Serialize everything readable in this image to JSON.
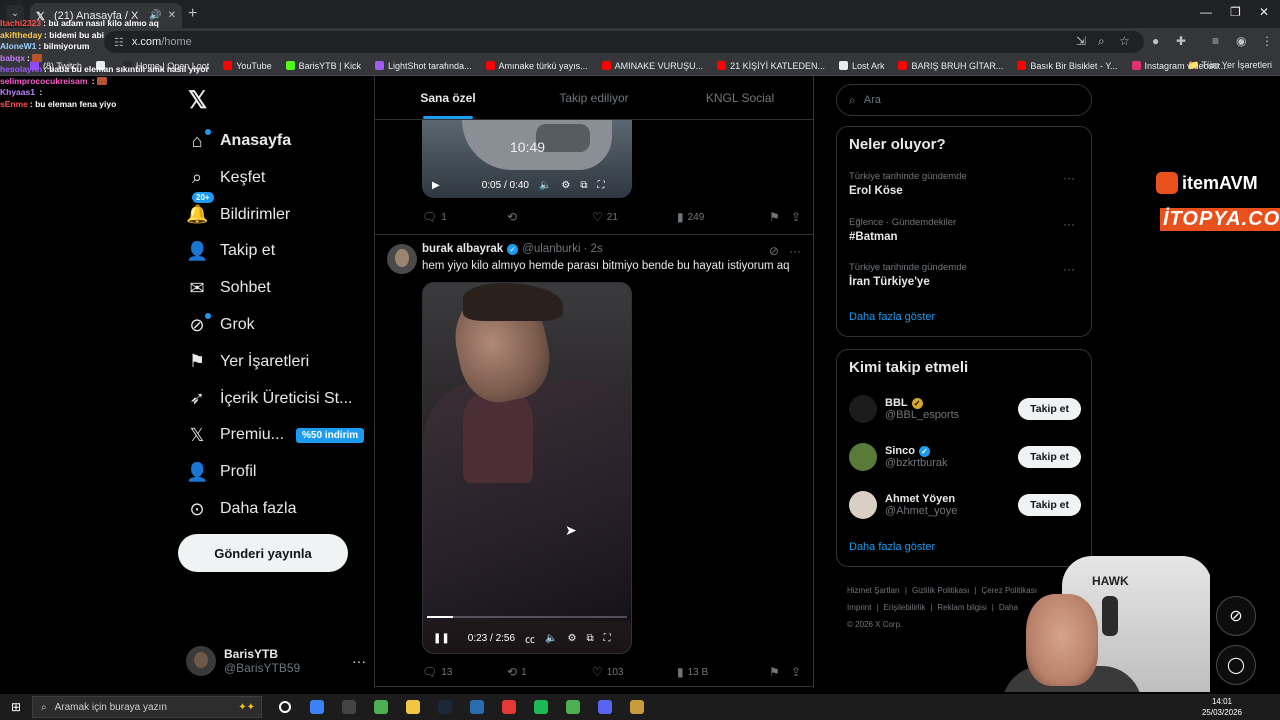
{
  "browser": {
    "tab": {
      "title": "(21) Anasayfa / X",
      "favicon": "x-logo-icon",
      "close": "✕"
    },
    "url_host": "x.com",
    "url_path": "/home",
    "bookmarks": [
      {
        "label": "(8) Twitch",
        "color": "#9146ff"
      },
      {
        "label": "",
        "color": "#e8eaed"
      },
      {
        "label": "Home | Open Loot",
        "color": "#2a2a2a"
      },
      {
        "label": "YouTube",
        "color": "#ff0000"
      },
      {
        "label": "BarisYTB | Kick",
        "color": "#53fc18"
      },
      {
        "label": "LightShot tarafında...",
        "color": "#a05cf0"
      },
      {
        "label": "Amınake türkü yayıs...",
        "color": "#ff0000"
      },
      {
        "label": "AMINAKE VURUŞU...",
        "color": "#ff0000"
      },
      {
        "label": "21 KİŞİYİ KATLEDEN...",
        "color": "#ff0000"
      },
      {
        "label": "Lost Ark",
        "color": "#e8eaed"
      },
      {
        "label": "BARIŞ BRUH GİTAR...",
        "color": "#ff0000"
      },
      {
        "label": "Basık Bir Bisiklet - Y...",
        "color": "#ff0000"
      },
      {
        "label": "Instagram videosu:...",
        "color": "#e1306c"
      }
    ],
    "all_bookmarks": "Tüm Yer İşaretleri"
  },
  "chat": [
    {
      "user": "Itachi2323",
      "color": "#ff4d4d",
      "text": ": bu adam nasıl kilo almıo aq"
    },
    {
      "user": "akiftheday",
      "color": "#f2c94c",
      "text": ": bidemi bu abi"
    },
    {
      "user": "AloneW1",
      "color": "#9ad0ff",
      "text": ": bilmiyorum"
    },
    {
      "user": "babqx",
      "color": "#c77dff",
      "text": ": "
    },
    {
      "user": "hesolaynn",
      "color": "#9b59ff",
      "text": ": baba bu eleman sıkıntılı amk nasıl yiyor"
    },
    {
      "user": "selimprococukreisam",
      "color": "#ff5ccd",
      "text": " : "
    },
    {
      "user": "Khyaas1",
      "color": "#c084fc",
      "text": " : "
    },
    {
      "user": "sEnme",
      "color": "#ff4d4d",
      "text": ": bu eleman fena yiyo"
    }
  ],
  "nav": {
    "items": [
      {
        "label": "Anasayfa",
        "icon": "home-icon"
      },
      {
        "label": "Keşfet",
        "icon": "search-icon"
      },
      {
        "label": "Bildirimler",
        "icon": "bell-icon",
        "badge": "20+"
      },
      {
        "label": "Takip et",
        "icon": "follow-icon"
      },
      {
        "label": "Sohbet",
        "icon": "mail-icon"
      },
      {
        "label": "Grok",
        "icon": "grok-icon"
      },
      {
        "label": "Yer İşaretleri",
        "icon": "bookmark-icon"
      },
      {
        "label": "İçerik Üreticisi St...",
        "icon": "rocket-icon"
      },
      {
        "label": "Premiu...",
        "icon": "x-premium-icon",
        "promo": "%50 indirim"
      },
      {
        "label": "Profil",
        "icon": "profile-icon"
      },
      {
        "label": "Daha fazla",
        "icon": "more-circle-icon"
      }
    ],
    "post_button": "Gönderi yayınla",
    "account": {
      "name": "BarisYTB",
      "handle": "@BarisYTB59"
    }
  },
  "feed": {
    "tabs": [
      "Sana özel",
      "Takip ediliyor",
      "KNGL Social"
    ],
    "post1": {
      "video_time": "0:05 / 0:40",
      "overlay_clock": "10:49",
      "stats": {
        "replies": "1",
        "reposts": "",
        "likes": "21",
        "views": "249"
      }
    },
    "post2": {
      "name": "burak albayrak",
      "handle": "@ulanburki",
      "time": "· 2s",
      "text": "hem yiyo kilo almıyo hemde parası bitmiyo bende bu hayatı istiyorum aq",
      "video_time": "0:23 / 2:56",
      "progress": 0.13,
      "stats": {
        "replies": "13",
        "reposts": "1",
        "likes": "103",
        "views": "13 B"
      }
    }
  },
  "right": {
    "search_placeholder": "Ara",
    "trends_title": "Neler oluyor?",
    "trends": [
      {
        "meta": "Türkiye tarihinde gündemde",
        "topic": "Erol Köse"
      },
      {
        "meta": "Eğlence · Gündemdekiler",
        "topic": "#Batman"
      },
      {
        "meta": "Türkiye tarihinde gündemde",
        "topic": "İran Türkiye'ye"
      }
    ],
    "show_more": "Daha fazla göster",
    "who_title": "Kimi takip etmeli",
    "who": [
      {
        "name": "BBL",
        "handle": "@BBL_esports",
        "badge": "gold",
        "avatar_color": "#1b1b1b"
      },
      {
        "name": "Sinco",
        "handle": "@bzkrtburak",
        "badge": "blue",
        "avatar_color": "#5a7a3a"
      },
      {
        "name": "Ahmet Yöyen",
        "handle": "@Ahmet_yoye",
        "badge": "",
        "avatar_color": "#d9cfc4"
      }
    ],
    "follow_label": "Takip et",
    "footer": {
      "links1": [
        "Hizmet Şartları",
        "Gizlilik Politikası",
        "Çerez Politikası"
      ],
      "links2": [
        "Imprint",
        "Erişilebilirlik",
        "Reklam bilgisi",
        "Daha"
      ],
      "copyright": "© 2026 X Corp."
    }
  },
  "overlay": {
    "itemavm": "itemAVM",
    "itopya": "İTOPYA.COM",
    "chair_brand": "HAWK"
  },
  "taskbar": {
    "search_placeholder": "Aramak için buraya yazın",
    "time": "14:01",
    "date": "25/03/2026",
    "apps": [
      {
        "name": "cortana",
        "color": "#ffffff"
      },
      {
        "name": "app-blue",
        "color": "#3b82f6"
      },
      {
        "name": "calculator",
        "color": "#444444"
      },
      {
        "name": "chrome",
        "color": "#4caf50"
      },
      {
        "name": "explorer",
        "color": "#f4c542"
      },
      {
        "name": "steam",
        "color": "#1b2838"
      },
      {
        "name": "terminal",
        "color": "#2b6cb0"
      },
      {
        "name": "discord-red",
        "color": "#e53935"
      },
      {
        "name": "spotify",
        "color": "#1db954"
      },
      {
        "name": "chrome2",
        "color": "#4caf50"
      },
      {
        "name": "discord",
        "color": "#5865f2"
      },
      {
        "name": "league",
        "color": "#c89b3c"
      }
    ]
  }
}
